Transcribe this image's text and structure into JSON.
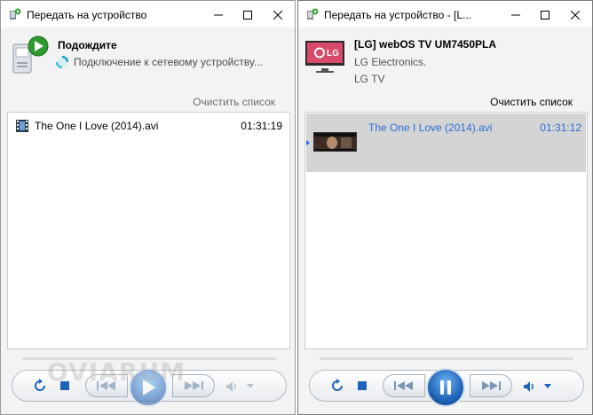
{
  "left_window": {
    "title": "Передать на устройство",
    "status_title": "Подождите",
    "status_text": "Подключение к сетевому устройству...",
    "clear_label": "Очистить список",
    "playlist": [
      {
        "title": "The One I Love (2014).avi",
        "duration": "01:31:19"
      }
    ],
    "state": "playing-disabled"
  },
  "right_window": {
    "title": "Передать на устройство - [L...",
    "device_name": "[LG] webOS TV UM7450PLA",
    "device_maker": "LG Electronics.",
    "device_model": "LG TV",
    "tv_logo_text": "LG",
    "clear_label": "Очистить список",
    "playlist": [
      {
        "title": "The One I Love (2014).avi",
        "duration": "01:31:12"
      }
    ],
    "state": "playing"
  },
  "watermark": "OVIARUM",
  "colors": {
    "accent": "#2a6fd6",
    "selected_row": "#d4d4d4",
    "window_bg": "#f3f3f3"
  },
  "icons": {
    "app": "cast-to-device-icon",
    "minimize": "minimize-icon",
    "maximize": "maximize-icon",
    "close": "close-icon",
    "film": "film-icon",
    "repeat": "repeat-icon",
    "stop": "stop-icon",
    "prev": "previous-icon",
    "next": "next-icon",
    "play": "play-icon",
    "pause": "pause-icon",
    "volume": "volume-icon"
  }
}
